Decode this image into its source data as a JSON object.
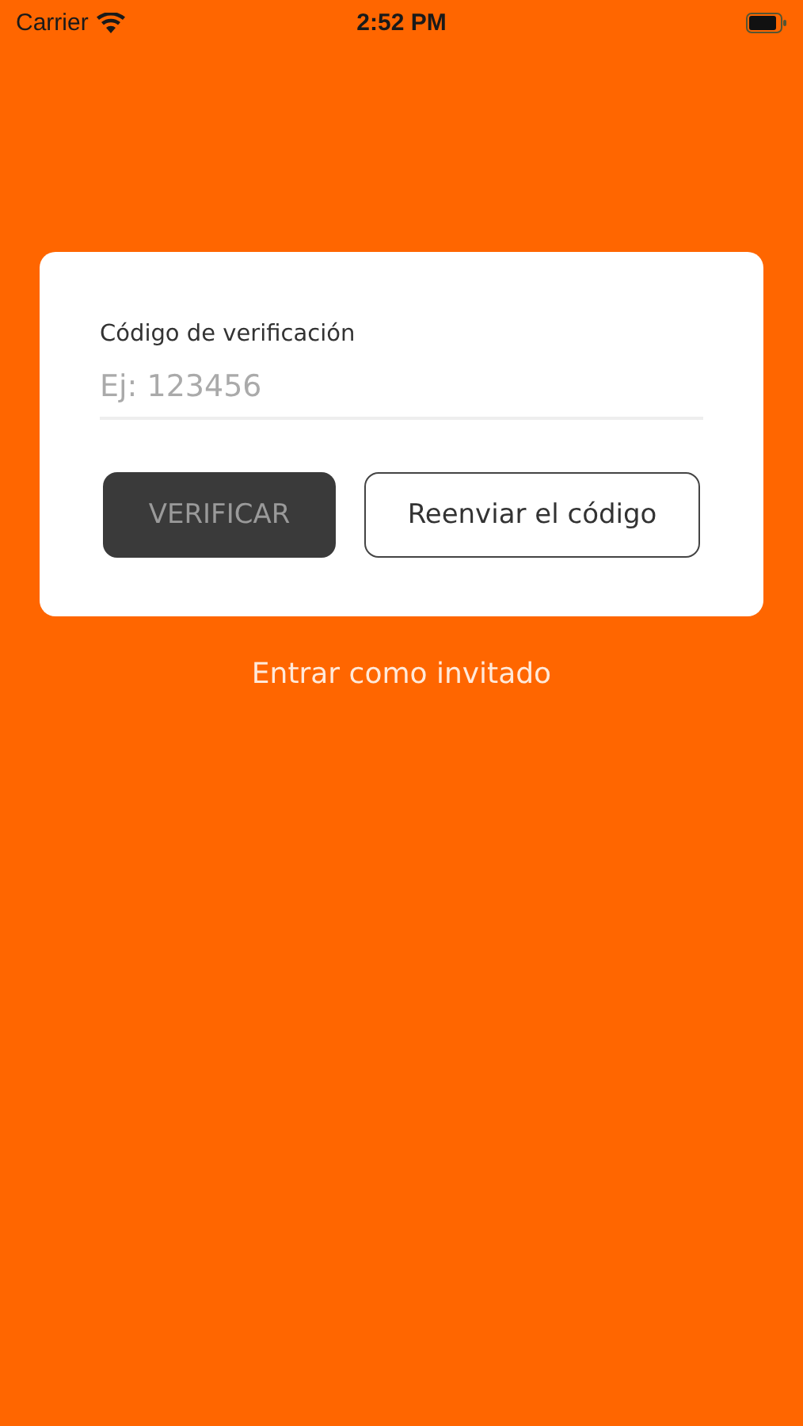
{
  "status_bar": {
    "carrier": "Carrier",
    "time": "2:52 PM"
  },
  "form": {
    "label": "Código de verificación",
    "code_field": {
      "placeholder": "Ej: 123456"
    },
    "buttons": [
      {
        "label": "VERIFICAR",
        "kind": "primary",
        "disabled": true
      },
      {
        "label": "Reenviar el código",
        "kind": "outline",
        "disabled": false
      }
    ]
  },
  "guest_link": "Entrar como invitado"
}
